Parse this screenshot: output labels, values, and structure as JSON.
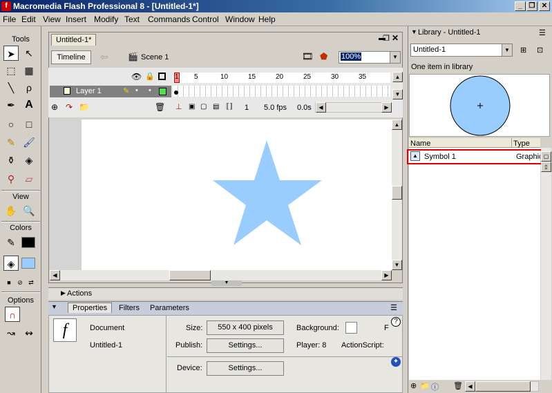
{
  "window": {
    "title": "Macromedia Flash Professional 8 - [Untitled-1*]",
    "logo": "f"
  },
  "menu": [
    "File",
    "Edit",
    "View",
    "Insert",
    "Modify",
    "Text",
    "Commands",
    "Control",
    "Window",
    "Help"
  ],
  "tools": {
    "header": "Tools",
    "view_header": "View",
    "colors_header": "Colors",
    "options_header": "Options"
  },
  "document": {
    "tab": "Untitled-1*",
    "timeline_button": "Timeline",
    "scene": "Scene 1",
    "zoom": "100%",
    "layer_name": "Layer 1",
    "ruler_ticks": [
      "1",
      "5",
      "10",
      "15",
      "20",
      "25",
      "30",
      "35"
    ],
    "frame": "1",
    "fps": "5.0 fps",
    "time": "0.0s",
    "star_color": "#99ccff"
  },
  "panels": {
    "actions": "Actions",
    "tabs": [
      "Properties",
      "Filters",
      "Parameters"
    ],
    "doc_type": "Document",
    "doc_name": "Untitled-1",
    "size_label": "Size:",
    "size_value": "550 x 400 pixels",
    "background_label": "Background:",
    "publish_label": "Publish:",
    "settings": "Settings...",
    "player": "Player: 8",
    "actionscript": "ActionScript:",
    "device_label": "Device:",
    "f_label": "F"
  },
  "library": {
    "title": "Library - Untitled-1",
    "dropdown": "Untitled-1",
    "count": "One item in library",
    "col_name": "Name",
    "col_type": "Type",
    "item_name": "Symbol 1",
    "item_type": "Graphic",
    "preview_color": "#99ccff"
  }
}
